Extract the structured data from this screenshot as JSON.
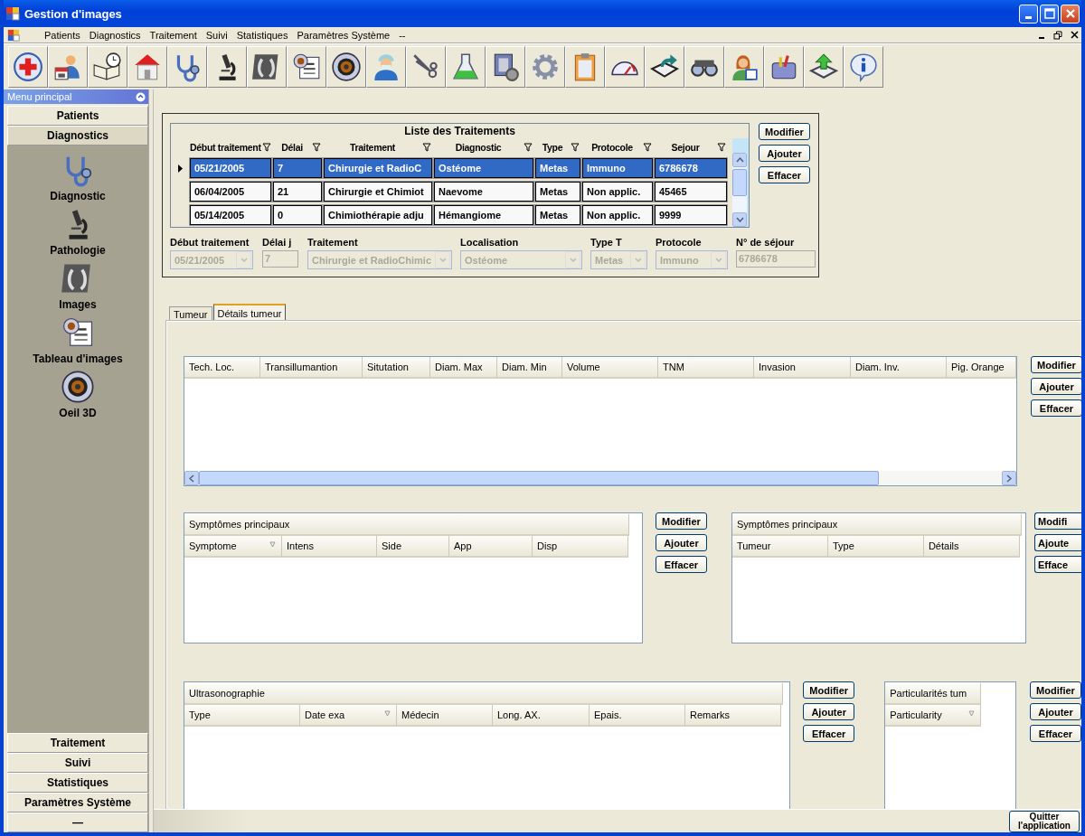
{
  "window": {
    "title": "Gestion d'images"
  },
  "menu": [
    "Patients",
    "Diagnostics",
    "Traitement",
    "Suivi",
    "Statistiques",
    "Paramètres Système",
    "--"
  ],
  "sidebar": {
    "title": "Menu principal",
    "top_items": [
      {
        "label": "Patients",
        "selected": false
      },
      {
        "label": "Diagnostics",
        "selected": true
      }
    ],
    "sub_items": [
      "Diagnostic",
      "Pathologie",
      "Images",
      "Tableau d'images",
      "Oeil 3D"
    ],
    "bottom_items": [
      "Traitement",
      "Suivi",
      "Statistiques",
      "Paramètres Système",
      "—"
    ]
  },
  "treatments": {
    "title": "Liste des Traitements",
    "columns": [
      "Début traitement",
      "Délai",
      "Traitement",
      "Diagnostic",
      "Type",
      "Protocole",
      "Sejour"
    ],
    "rows": [
      {
        "selected": true,
        "cells": [
          "05/21/2005",
          "7",
          "Chirurgie et RadioC",
          "Ostéome",
          "Metas",
          "Immuno",
          "6786678"
        ]
      },
      {
        "selected": false,
        "cells": [
          "06/04/2005",
          "21",
          "Chirurgie et Chimiot",
          "Naevome",
          "Metas",
          "Non applic.",
          "45465"
        ]
      },
      {
        "selected": false,
        "cells": [
          "05/14/2005",
          "0",
          "Chimiothérapie adju",
          "Hémangiome",
          "Metas",
          "Non applic.",
          "9999"
        ]
      }
    ],
    "buttons": [
      "Modifier",
      "Ajouter",
      "Effacer"
    ],
    "fields": [
      {
        "label": "Début traitement",
        "value": "05/21/2005",
        "kind": "combo"
      },
      {
        "label": "Délai j",
        "value": "7",
        "kind": "text"
      },
      {
        "label": "Traitement",
        "value": "Chirurgie et RadioChimic",
        "kind": "combo"
      },
      {
        "label": "Localisation",
        "value": "Ostéome",
        "kind": "combo"
      },
      {
        "label": "Type T",
        "value": "Metas",
        "kind": "combo"
      },
      {
        "label": "Protocole",
        "value": "Immuno",
        "kind": "combo"
      },
      {
        "label": "N° de séjour",
        "value": "6786678",
        "kind": "text"
      }
    ]
  },
  "tabs": [
    {
      "label": "Tumeur",
      "selected": false
    },
    {
      "label": "Détails tumeur",
      "selected": true
    }
  ],
  "tumor_grid": {
    "columns": [
      {
        "label": "Tech. Loc.",
        "sorted": false
      },
      {
        "label": "Transillumantion",
        "sorted": false
      },
      {
        "label": "Situtation",
        "sorted": false
      },
      {
        "label": "Diam. Max",
        "sorted": false
      },
      {
        "label": "Diam. Min",
        "sorted": false
      },
      {
        "label": "Volume",
        "sorted": false
      },
      {
        "label": "TNM",
        "sorted": false
      },
      {
        "label": "Invasion",
        "sorted": false
      },
      {
        "label": "Diam. Inv.",
        "sorted": false
      },
      {
        "label": "Pig. Orange",
        "sorted": false
      }
    ],
    "buttons": [
      "Modifier",
      "Ajouter",
      "Effacer"
    ]
  },
  "symptoms_left": {
    "title": "Symptômes principaux",
    "columns": [
      {
        "label": "Symptome",
        "sorted": true
      },
      {
        "label": "Intens",
        "sorted": false
      },
      {
        "label": "Side",
        "sorted": false
      },
      {
        "label": "App",
        "sorted": false
      },
      {
        "label": "Disp",
        "sorted": false
      }
    ],
    "buttons": [
      "Modifier",
      "Ajouter",
      "Effacer"
    ]
  },
  "symptoms_right": {
    "title": "Symptômes principaux",
    "columns": [
      {
        "label": "Tumeur",
        "sorted": false
      },
      {
        "label": "Type",
        "sorted": false
      },
      {
        "label": "Détails",
        "sorted": false
      }
    ],
    "buttons": [
      "Modifi",
      "Ajoute",
      "Efface"
    ]
  },
  "ultrasound": {
    "title": "Ultrasonographie",
    "columns": [
      {
        "label": "Type",
        "sorted": false
      },
      {
        "label": "Date exa",
        "sorted": true
      },
      {
        "label": "Médecin",
        "sorted": false
      },
      {
        "label": "Long. AX.",
        "sorted": false
      },
      {
        "label": "Epais.",
        "sorted": false
      },
      {
        "label": "Remarks",
        "sorted": false
      }
    ],
    "buttons": [
      "Modifier",
      "Ajouter",
      "Effacer"
    ]
  },
  "particularities": {
    "title": "Particularités tum",
    "columns": [
      {
        "label": "Particularity",
        "sorted": true
      }
    ],
    "buttons": [
      "Modifier",
      "Ajouter",
      "Effacer"
    ]
  },
  "status_bar": {
    "quit_button": "Quitter l'application"
  }
}
